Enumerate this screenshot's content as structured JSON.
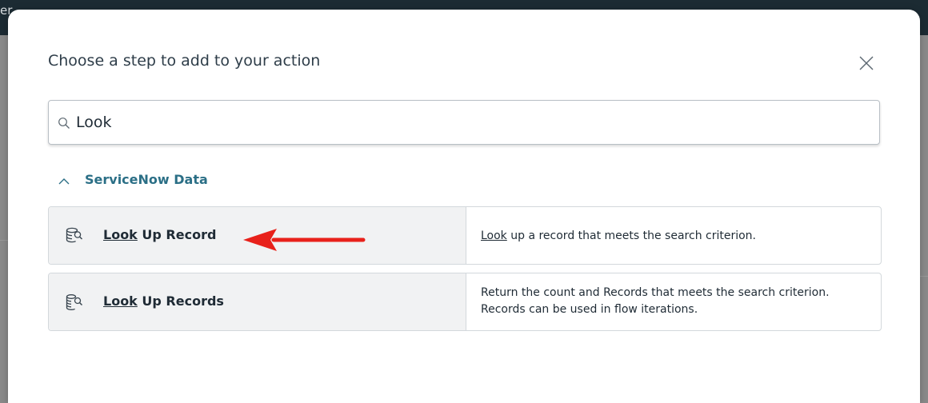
{
  "background": {
    "topbar_text": "er"
  },
  "modal": {
    "title": "Choose a step to add to your action"
  },
  "search": {
    "value": "Look",
    "icon": "search-icon"
  },
  "section": {
    "label": "ServiceNow Data",
    "icon": "chevron-up-icon"
  },
  "steps": [
    {
      "name_highlight": "Look",
      "name_rest": " Up Record",
      "desc_highlight": "Look",
      "desc_rest": " up a record that meets the search criterion.",
      "icon": "database-search-icon"
    },
    {
      "name_highlight": "Look",
      "name_rest": " Up Records",
      "desc_line1": "Return the count and Records that meets the search criterion.",
      "desc_line2": "Records can be used in flow iterations.",
      "icon": "database-multi-search-icon"
    }
  ],
  "annotation": {
    "arrow_color": "#e8211b"
  },
  "colors": {
    "accent": "#2b6f86",
    "text": "#1f2b35",
    "row_left_bg": "#f1f2f3"
  }
}
